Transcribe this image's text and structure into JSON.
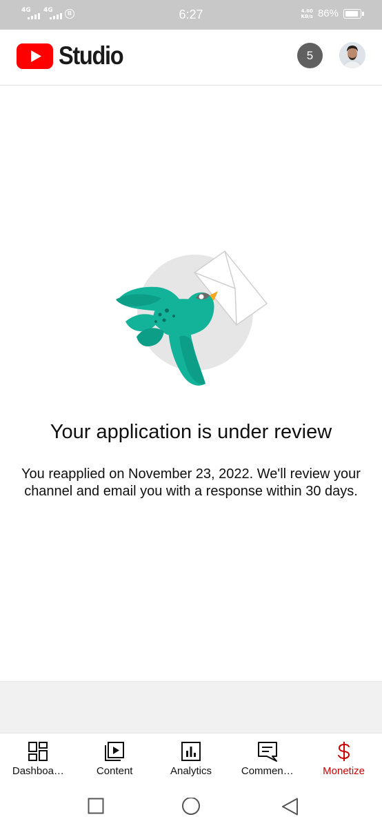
{
  "status_bar": {
    "signal_1": "4G",
    "signal_2": "4G",
    "b_badge": "B",
    "time": "6:27",
    "speed_value": "4.60",
    "speed_unit": "KB/s",
    "battery_percent": "86%"
  },
  "header": {
    "logo_text": "Studio",
    "notification_count": "5"
  },
  "main": {
    "title": "Your application is under review",
    "description": "You reapplied on November 23, 2022. We'll review your channel and email you with a response within 30 days."
  },
  "bottom_nav": {
    "items": [
      {
        "label": "Dashboa…",
        "icon": "dashboard-icon"
      },
      {
        "label": "Content",
        "icon": "content-icon"
      },
      {
        "label": "Analytics",
        "icon": "analytics-icon"
      },
      {
        "label": "Commen…",
        "icon": "comments-icon"
      },
      {
        "label": "Monetize",
        "icon": "dollar-icon"
      }
    ],
    "active_index": 4
  },
  "colors": {
    "youtube_red": "#ff0000",
    "active_red": "#cc0000",
    "teal": "#13b39a",
    "status_bar_bg": "#c8c8c8"
  }
}
